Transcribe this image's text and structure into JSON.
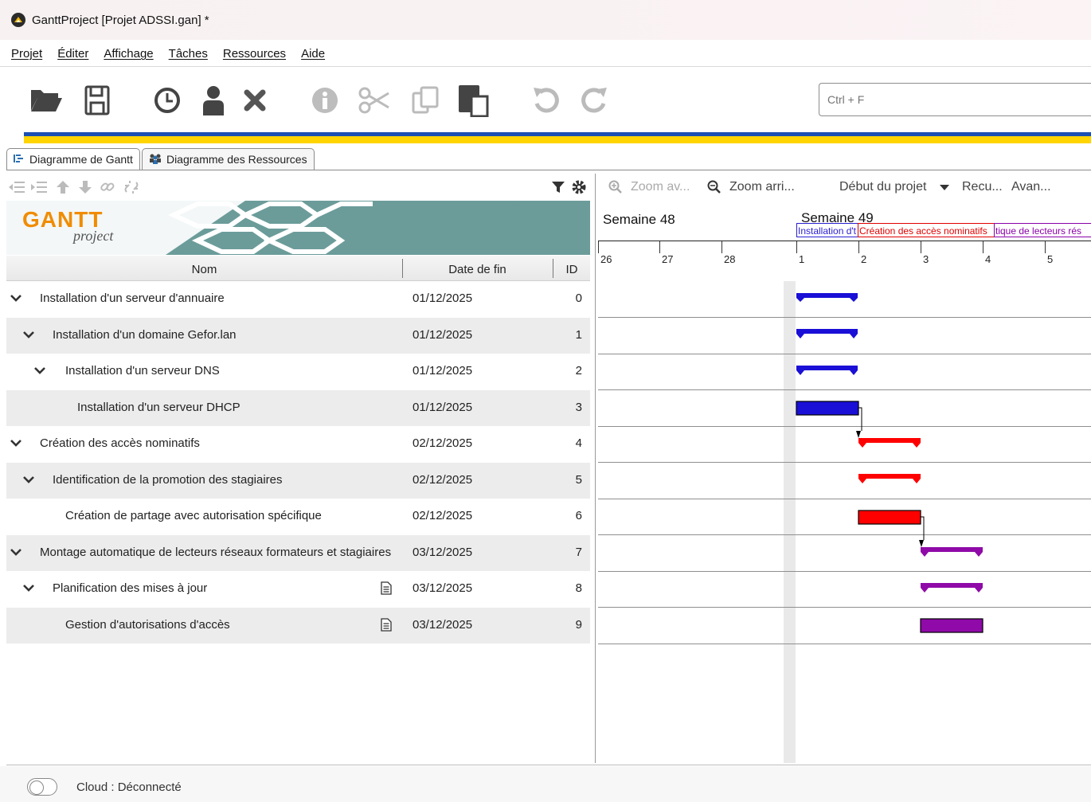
{
  "window": {
    "title": "GanttProject [Projet ADSSI.gan] *"
  },
  "menu": [
    "Projet",
    "Éditer",
    "Affichage",
    "Tâches",
    "Ressources",
    "Aide"
  ],
  "toolbar": {
    "icons": [
      "folder-open-icon",
      "save-icon",
      "clock-icon",
      "person-icon",
      "delete-icon",
      "info-icon",
      "cut-icon",
      "copy-icon",
      "paste-icon",
      "undo-icon",
      "redo-icon"
    ],
    "search_placeholder": "Ctrl + F"
  },
  "tabs": [
    {
      "label": "Diagramme de Gantt",
      "icon": "gantt-tab-icon",
      "active": true
    },
    {
      "label": "Diagramme des Ressources",
      "icon": "resources-tab-icon",
      "active": false
    }
  ],
  "banner": {
    "logo_text": "GANTT",
    "logo_sub": "project"
  },
  "table": {
    "columns": [
      "Nom",
      "Date de fin",
      "ID"
    ],
    "rows": [
      {
        "name": "Installation d'un serveur d'annuaire",
        "date": "01/12/2025",
        "id": "0",
        "level": 0,
        "expand": true,
        "note": false
      },
      {
        "name": "Installation d'un domaine Gefor.lan",
        "date": "01/12/2025",
        "id": "1",
        "level": 1,
        "expand": true,
        "note": false
      },
      {
        "name": "Installation d'un serveur DNS",
        "date": "01/12/2025",
        "id": "2",
        "level": 2,
        "expand": true,
        "note": false
      },
      {
        "name": "Installation d'un serveur DHCP",
        "date": "01/12/2025",
        "id": "3",
        "level": 3,
        "expand": false,
        "note": false
      },
      {
        "name": "Création des accès nominatifs",
        "date": "02/12/2025",
        "id": "4",
        "level": 0,
        "expand": true,
        "note": false
      },
      {
        "name": "Identification de la promotion des stagiaires",
        "date": "02/12/2025",
        "id": "5",
        "level": 1,
        "expand": true,
        "note": false
      },
      {
        "name": "Création de partage avec autorisation spécifique",
        "date": "02/12/2025",
        "id": "6",
        "level": 2,
        "expand": false,
        "note": false
      },
      {
        "name": "Montage automatique de lecteurs réseaux formateurs et stagiaires",
        "date": "03/12/2025",
        "id": "7",
        "level": 0,
        "expand": true,
        "note": false
      },
      {
        "name": "Planification des mises à jour",
        "date": "03/12/2025",
        "id": "8",
        "level": 1,
        "expand": true,
        "note": true
      },
      {
        "name": "Gestion d'autorisations d'accès",
        "date": "03/12/2025",
        "id": "9",
        "level": 2,
        "expand": false,
        "note": true
      }
    ]
  },
  "gantt_toolbar": {
    "zoom_in": "Zoom av...",
    "zoom_out": "Zoom arri...",
    "project_start": "Début du projet",
    "back": "Recu...",
    "forward": "Avan..."
  },
  "timeline": {
    "weeks": [
      "Semaine 48",
      "Semaine 49"
    ],
    "days": [
      "26",
      "27",
      "28",
      "1",
      "2",
      "3",
      "4",
      "5"
    ],
    "labels": [
      {
        "text": "Installation d't",
        "color": "#2a1fcf"
      },
      {
        "text": "Création des accès nominatifs",
        "color": "#e00000"
      },
      {
        "text": "tique de lecteurs rés",
        "color": "#8a00a8"
      }
    ]
  },
  "colors": {
    "blue": "#1a0fd6",
    "red": "#ff0000",
    "purple": "#8f0aa8"
  },
  "status": {
    "cloud": "Cloud : Déconnecté"
  }
}
